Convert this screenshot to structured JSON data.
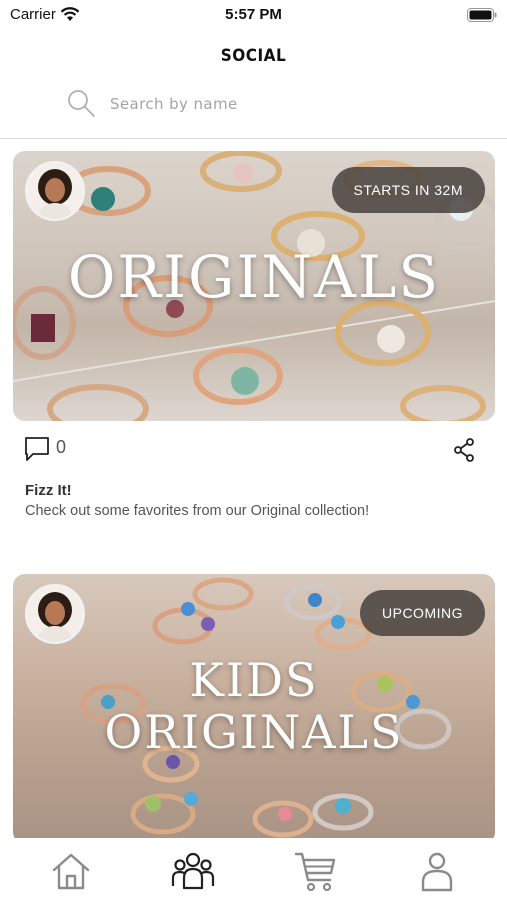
{
  "status_bar": {
    "carrier": "Carrier",
    "time": "5:57 PM"
  },
  "header": {
    "title": "SOCIAL"
  },
  "search": {
    "placeholder": "Search by name"
  },
  "posts": [
    {
      "collection_title": "ORIGINALS",
      "status": "STARTS IN 32M",
      "comment_count": "0",
      "author": "Fizz It!",
      "caption": "Check out some favorites from our Original collection!"
    },
    {
      "collection_title_line1": "KIDS",
      "collection_title_line2": "ORIGINALS",
      "status": "UPCOMING"
    }
  ],
  "tab_bar": {
    "items": [
      {
        "icon": "home-icon",
        "active": false
      },
      {
        "icon": "people-icon",
        "active": true
      },
      {
        "icon": "cart-icon",
        "active": false
      },
      {
        "icon": "profile-icon",
        "active": false
      }
    ]
  },
  "colors": {
    "icon_inactive": "#8a8a8a",
    "icon_active": "#222222",
    "pill_bg": "#423c38"
  }
}
